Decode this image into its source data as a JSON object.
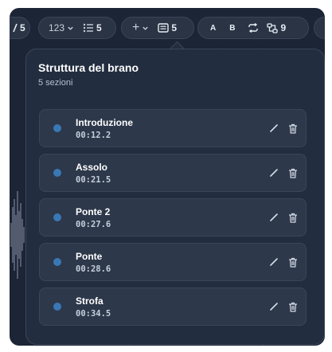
{
  "colors": {
    "background": "#1c2535",
    "panel": "#222d3f",
    "row": "#2d384a",
    "section_dot": "#3a78b5",
    "text": "#ffffff"
  },
  "toolbar": {
    "partial_left_count": "5",
    "number_format_label": "123",
    "list_count": "5",
    "add_label": "+",
    "sections_count": "5",
    "marker_a": "A",
    "marker_b": "B",
    "loop_count": "9",
    "icons": [
      "chevron-down-icon",
      "list-icon",
      "plus-icon",
      "sections-icon",
      "loop-icon",
      "nodes-icon"
    ]
  },
  "panel": {
    "title": "Struttura del brano",
    "subtitle": "5 sezioni",
    "sections": [
      {
        "name": "Introduzione",
        "time": "00:12.2"
      },
      {
        "name": "Assolo",
        "time": "00:21.5"
      },
      {
        "name": "Ponte 2",
        "time": "00:27.6"
      },
      {
        "name": "Ponte",
        "time": "00:28.6"
      },
      {
        "name": "Strofa",
        "time": "00:34.5"
      }
    ],
    "row_icons": [
      "pencil-icon",
      "trash-icon"
    ]
  }
}
